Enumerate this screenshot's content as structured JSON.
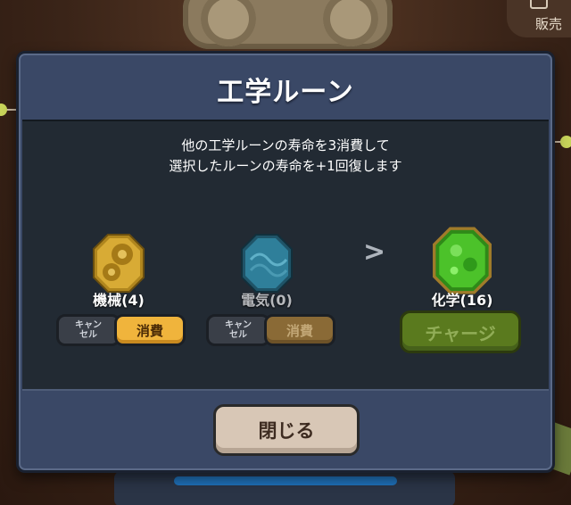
{
  "background": {
    "sell_label": "販売"
  },
  "dialog": {
    "title": "工学ルーン",
    "description_line1": "他の工学ルーンの寿命を3消費して",
    "description_line2": "選択したルーンの寿命を+1回復します",
    "runes": [
      {
        "name": "機械(4)",
        "icon": "mechanical-rune-icon",
        "color": "#d4a62a",
        "cancel_label": "キャンセル",
        "consume_label": "消費",
        "consume_enabled": true
      },
      {
        "name": "電気(0)",
        "icon": "electric-rune-icon",
        "color": "#2f7f9a",
        "cancel_label": "キャンセル",
        "consume_label": "消費",
        "consume_enabled": false
      }
    ],
    "arrow_icon": "chevron-right-icon",
    "target_rune": {
      "name": "化学(16)",
      "icon": "chemical-rune-icon",
      "color": "#4cc22a",
      "charge_label": "チャージ"
    },
    "close_label": "閉じる"
  }
}
